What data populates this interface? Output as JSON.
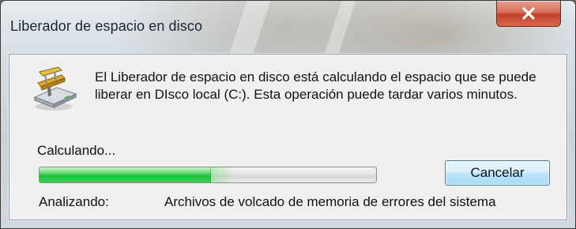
{
  "window": {
    "title": "Liberador de espacio en disco"
  },
  "titlebar": {
    "close_icon": "close-x-icon"
  },
  "dialog": {
    "icon": "disk-cleanup-icon",
    "message": "El Liberador de espacio en disco está calculando el espacio que se puede liberar en DIsco local (C:). Esta operación puede tardar varios minutos.",
    "status_label": "Calculando...",
    "progress": 0.51,
    "cancel_label": "Cancelar",
    "analyzing_label": "Analizando:",
    "analyzing_value": "Archivos de volcado de memoria de errores del sistema"
  },
  "colors": {
    "progress_fill": "#1fbd3a",
    "close_button": "#c1402a",
    "button_border": "#3c7fb1"
  }
}
